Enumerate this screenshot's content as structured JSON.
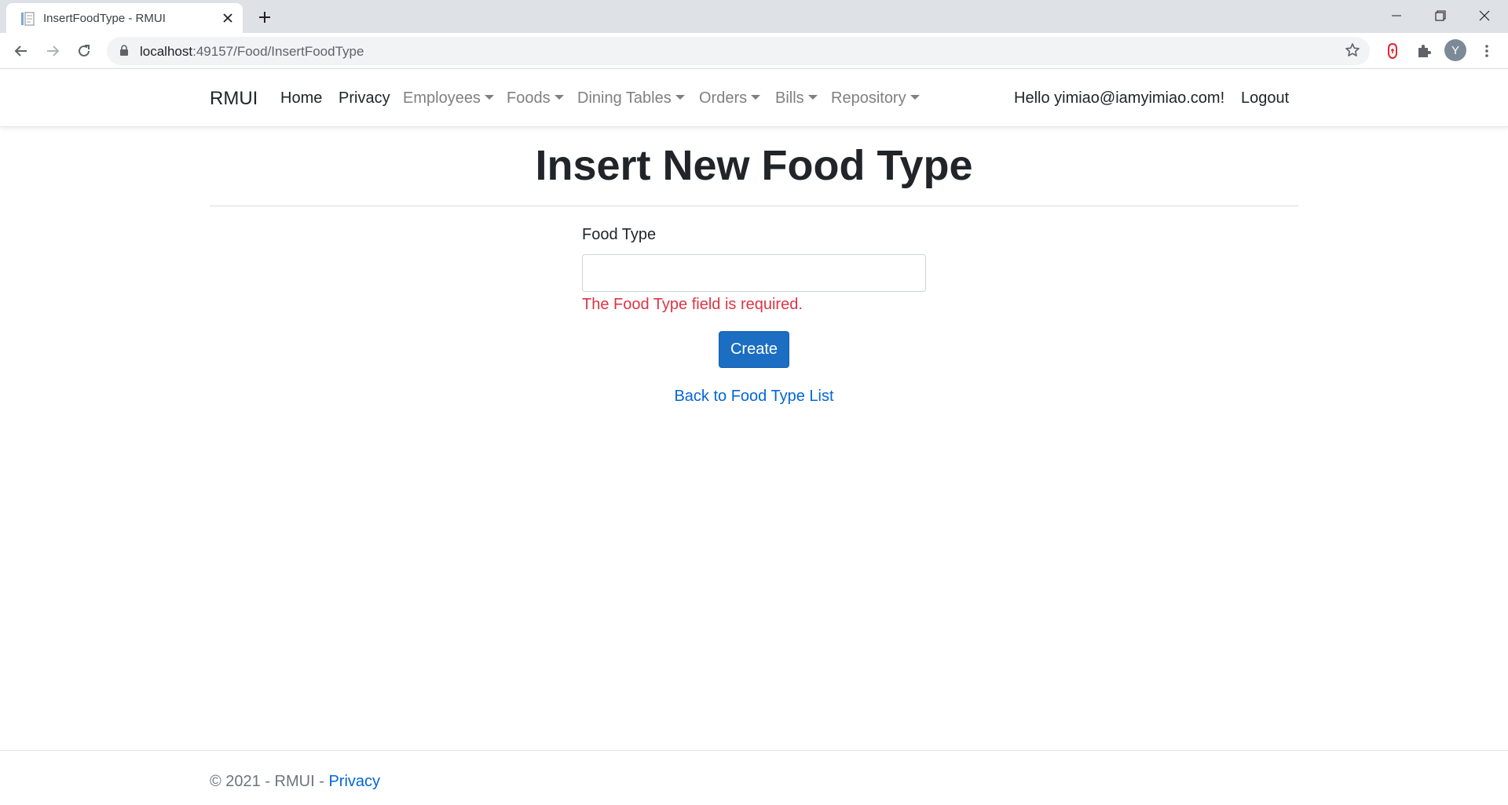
{
  "browser": {
    "tab_title": "InsertFoodType - RMUI",
    "url_host": "localhost",
    "url_path": ":49157/Food/InsertFoodType",
    "avatar_letter": "Y"
  },
  "navbar": {
    "brand": "RMUI",
    "items": [
      {
        "label": "Home",
        "dropdown": false
      },
      {
        "label": "Privacy",
        "dropdown": false
      },
      {
        "label": "Employees",
        "dropdown": true
      },
      {
        "label": "Foods",
        "dropdown": true
      },
      {
        "label": "Dining Tables",
        "dropdown": true
      },
      {
        "label": "Orders",
        "dropdown": true
      },
      {
        "label": "Bills",
        "dropdown": true
      },
      {
        "label": "Repository",
        "dropdown": true
      }
    ],
    "greeting": "Hello yimiao@iamyimiao.com!",
    "logout": "Logout"
  },
  "main": {
    "title": "Insert New Food Type",
    "field_label": "Food Type",
    "field_value": "",
    "error": "The Food Type field is required.",
    "create_label": "Create",
    "back_link": "Back to Food Type List"
  },
  "footer": {
    "text": "© 2021 - RMUI - ",
    "privacy_link": "Privacy"
  },
  "colors": {
    "primary": "#1b6ec2",
    "link": "#0366d6",
    "error": "#dc3545",
    "muted_nav": "#808080"
  },
  "icons": [
    "page-favicon-icon",
    "close-icon",
    "plus-icon",
    "minimize-icon",
    "restore-icon",
    "window-close-icon",
    "back-arrow-icon",
    "forward-arrow-icon",
    "reload-icon",
    "lock-icon",
    "star-icon",
    "extension-red-icon",
    "puzzle-icon",
    "more-vert-icon",
    "caret-down-icon"
  ]
}
